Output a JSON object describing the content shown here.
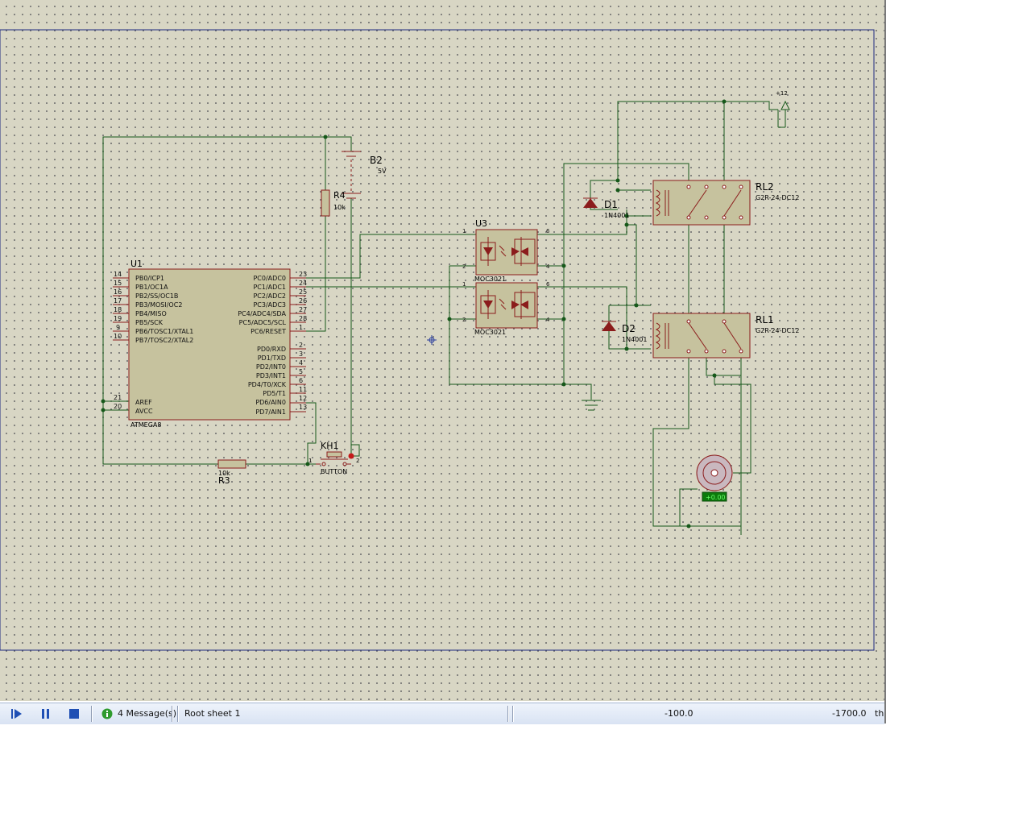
{
  "schematic": {
    "u1": {
      "ref": "U1",
      "part": "ATMEGA8",
      "left_pins": [
        {
          "num": "14",
          "name": "PB0/ICP1"
        },
        {
          "num": "15",
          "name": "PB1/OC1A"
        },
        {
          "num": "16",
          "name": "PB2/SS/OC1B"
        },
        {
          "num": "17",
          "name": "PB3/MOSI/OC2"
        },
        {
          "num": "18",
          "name": "PB4/MISO"
        },
        {
          "num": "19",
          "name": "PB5/SCK"
        },
        {
          "num": "9",
          "name": "PB6/TOSC1/XTAL1"
        },
        {
          "num": "10",
          "name": "PB7/TOSC2/XTAL2"
        }
      ],
      "left_pins2": [
        {
          "num": "21",
          "name": "AREF"
        },
        {
          "num": "20",
          "name": "AVCC"
        }
      ],
      "right_pins": [
        {
          "num": "23",
          "name": "PC0/ADC0"
        },
        {
          "num": "24",
          "name": "PC1/ADC1"
        },
        {
          "num": "25",
          "name": "PC2/ADC2"
        },
        {
          "num": "26",
          "name": "PC3/ADC3"
        },
        {
          "num": "27",
          "name": "PC4/ADC4/SDA"
        },
        {
          "num": "28",
          "name": "PC5/ADC5/SCL"
        },
        {
          "num": "1",
          "name": "PC6/RESET"
        }
      ],
      "right_pins2": [
        {
          "num": "2",
          "name": "PD0/RXD"
        },
        {
          "num": "3",
          "name": "PD1/TXD"
        },
        {
          "num": "4",
          "name": "PD2/INT0"
        },
        {
          "num": "5",
          "name": "PD3/INT1"
        },
        {
          "num": "6",
          "name": "PD4/T0/XCK"
        },
        {
          "num": "11",
          "name": "PD5/T1"
        },
        {
          "num": "12",
          "name": "PD6/AIN0"
        },
        {
          "num": "13",
          "name": "PD7/AIN1"
        }
      ]
    },
    "b2": {
      "ref": "B2",
      "value": "5V"
    },
    "r4": {
      "ref": "R4",
      "value": "10k"
    },
    "r3": {
      "ref": "R3",
      "value": "10k"
    },
    "kh1": {
      "ref": "KH1",
      "part": "BUTTON",
      "pin1": "1",
      "pin2": "2"
    },
    "u3": {
      "ref": "U3",
      "part1": "MOC3021",
      "part2": "MOC3021",
      "p1": "1",
      "p2": "2",
      "p4": "4",
      "p6": "6"
    },
    "d1": {
      "ref": "D1",
      "part": "1N4001"
    },
    "d2": {
      "ref": "D2",
      "part": "1N4001"
    },
    "rl2": {
      "ref": "RL2",
      "part": "G2R-24-DC12"
    },
    "rl1": {
      "ref": "RL1",
      "part": "G2R-24-DC12"
    },
    "power": {
      "label": "+12"
    },
    "motor": {
      "readout": "+0.00"
    }
  },
  "status": {
    "messages": "4 Message(s)",
    "sheet": "Root sheet 1",
    "x": "-100.0",
    "y": "-1700.0",
    "unit": "th"
  },
  "colors": {
    "canvas": "#d8d6c4",
    "wire": "#16581a",
    "component": "#8b1c1c",
    "border": "#1e2a80"
  }
}
